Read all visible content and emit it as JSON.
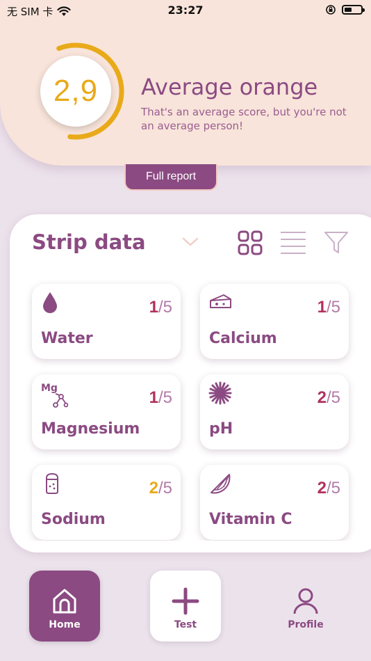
{
  "status_bar": {
    "carrier": "无 SIM 卡",
    "time": "23:27",
    "battery_level": 0.45
  },
  "score": {
    "value": "2,9",
    "title": "Average orange",
    "subtitle": "That's an average score, but you're not an average person!",
    "ring_fraction": 0.58
  },
  "full_report_label": "Full report",
  "strip": {
    "title": "Strip data",
    "tiles": [
      {
        "name": "Water",
        "score": "1",
        "denominator": "/5",
        "icon": "water-drop-icon",
        "score_color": "#b0325e"
      },
      {
        "name": "Calcium",
        "score": "1",
        "denominator": "/5",
        "icon": "cheese-icon",
        "score_color": "#b0325e"
      },
      {
        "name": "Magnesium",
        "score": "1",
        "denominator": "/5",
        "icon": "magnesium-molecule-icon",
        "score_color": "#b0325e",
        "icon_text": "Mg"
      },
      {
        "name": "pH",
        "score": "2",
        "denominator": "/5",
        "icon": "ph-burst-icon",
        "score_color": "#b0325e"
      },
      {
        "name": "Sodium",
        "score": "2",
        "denominator": "/5",
        "icon": "salt-shaker-icon",
        "score_color": "#e9aa1a"
      },
      {
        "name": "Vitamin C",
        "score": "2",
        "denominator": "/5",
        "icon": "citrus-slice-icon",
        "score_color": "#b0325e"
      }
    ]
  },
  "nav": {
    "home": "Home",
    "test": "Test",
    "profile": "Profile"
  },
  "colors": {
    "brand": "#8b4a82",
    "accent": "#e9aa1a",
    "hero_bg": "#f8e4da",
    "page_bg": "#ece2ec"
  }
}
